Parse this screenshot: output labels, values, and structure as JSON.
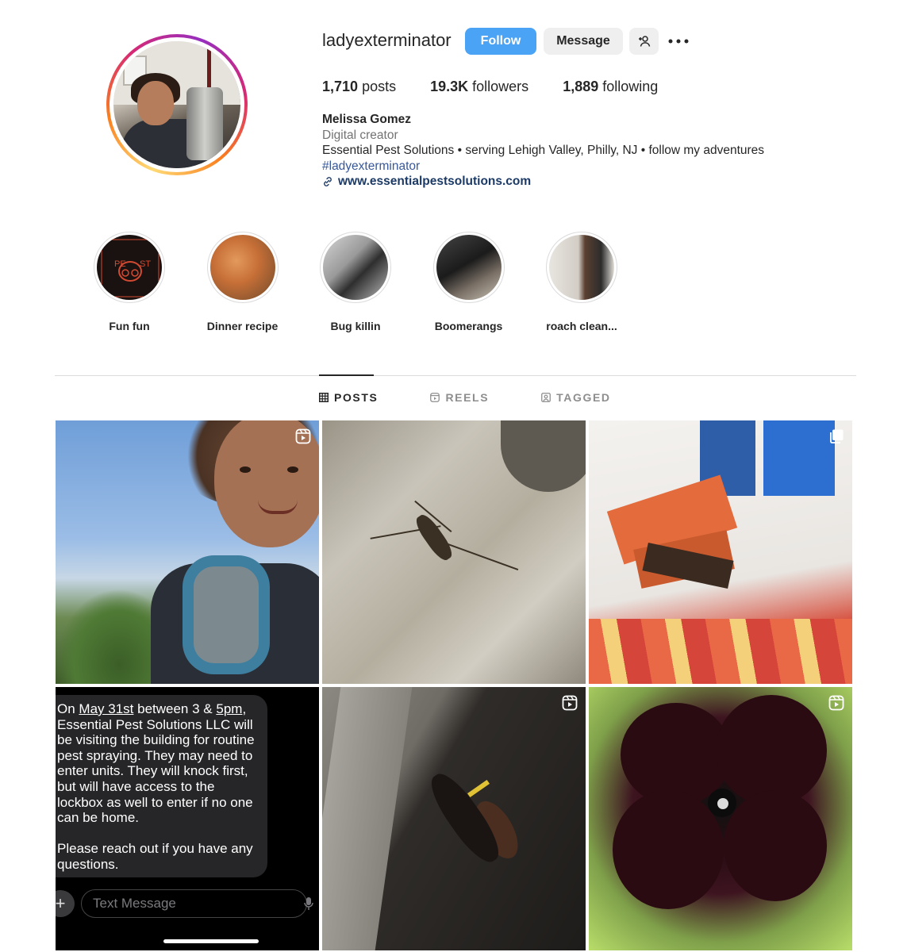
{
  "profile": {
    "username": "ladyexterminator",
    "follow_label": "Follow",
    "message_label": "Message",
    "stats": [
      {
        "value": "1,710",
        "label": "posts"
      },
      {
        "value": "19.3K",
        "label": "followers"
      },
      {
        "value": "1,889",
        "label": "following"
      }
    ],
    "full_name": "Melissa Gomez",
    "category": "Digital creator",
    "bio_line": "Essential Pest Solutions • serving Lehigh Valley, Philly, NJ • follow my adventures",
    "hashtag": "#ladyexterminator",
    "website": "www.essentialpestsolutions.com"
  },
  "highlights": [
    {
      "label": "Fun fun"
    },
    {
      "label": "Dinner recipe"
    },
    {
      "label": "Bug killin"
    },
    {
      "label": "Boomerangs"
    },
    {
      "label": "roach clean..."
    }
  ],
  "tabs": [
    {
      "label": "POSTS",
      "icon": "grid-icon",
      "active": true
    },
    {
      "label": "REELS",
      "icon": "reels-icon",
      "active": false
    },
    {
      "label": "TAGGED",
      "icon": "tagged-icon",
      "active": false
    }
  ],
  "posts": {
    "sms_text": {
      "line_before_date": "On ",
      "date": "May 31st",
      "between": " between 3 & ",
      "time": "5pm",
      "body": ", Essential Pest Solutions LLC will be visiting the building for routine pest spraying. They may need to enter units. They will knock first, but will have access to the lockbox as well to enter if no one can be home.",
      "closing": "Please reach out if you have any questions.",
      "input_placeholder": "Text Message"
    }
  },
  "colors": {
    "follow_button": "#4aa3f5",
    "secondary_button": "#efefef",
    "hashtag": "#385898",
    "link": "#1c3a66"
  }
}
